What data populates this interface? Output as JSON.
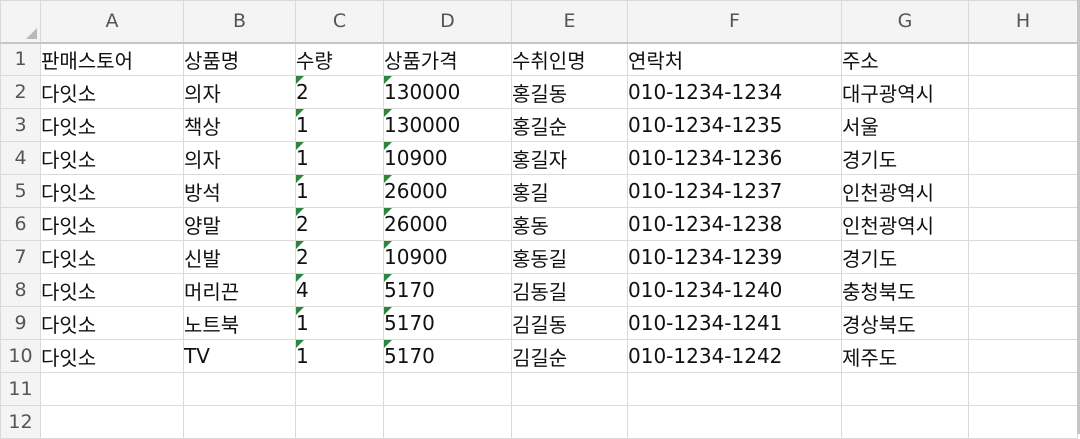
{
  "columns": [
    "A",
    "B",
    "C",
    "D",
    "E",
    "F",
    "G",
    "H"
  ],
  "row_numbers": [
    "1",
    "2",
    "3",
    "4",
    "5",
    "6",
    "7",
    "8",
    "9",
    "10",
    "11",
    "12"
  ],
  "rows": [
    [
      "판매스토어",
      "상품명",
      "수량",
      "상품가격",
      "수취인명",
      "연락처",
      "주소",
      ""
    ],
    [
      "다잇소",
      "의자",
      "2",
      "130000",
      "홍길동",
      "010-1234-1234",
      "대구광역시",
      ""
    ],
    [
      "다잇소",
      "책상",
      "1",
      "130000",
      "홍길순",
      "010-1234-1235",
      "서울",
      ""
    ],
    [
      "다잇소",
      "의자",
      "1",
      "10900",
      "홍길자",
      "010-1234-1236",
      "경기도",
      ""
    ],
    [
      "다잇소",
      "방석",
      "1",
      "26000",
      "홍길",
      "010-1234-1237",
      "인천광역시",
      ""
    ],
    [
      "다잇소",
      "양말",
      "2",
      "26000",
      "홍동",
      "010-1234-1238",
      "인천광역시",
      ""
    ],
    [
      "다잇소",
      "신발",
      "2",
      "10900",
      "홍동길",
      "010-1234-1239",
      "경기도",
      ""
    ],
    [
      "다잇소",
      "머리끈",
      "4",
      "5170",
      "김동길",
      "010-1234-1240",
      "충청북도",
      ""
    ],
    [
      "다잇소",
      "노트북",
      "1",
      "5170",
      "김길동",
      "010-1234-1241",
      "경상북도",
      ""
    ],
    [
      "다잇소",
      "TV",
      "1",
      "5170",
      "김길순",
      "010-1234-1242",
      "제주도",
      ""
    ],
    [
      "",
      "",
      "",
      "",
      "",
      "",
      "",
      ""
    ],
    [
      "",
      "",
      "",
      "",
      "",
      "",
      "",
      ""
    ]
  ],
  "colors": {
    "text_as_number_flag": "#2e8540",
    "header_background": "#f4f4f4",
    "gridline": "#dadada"
  }
}
